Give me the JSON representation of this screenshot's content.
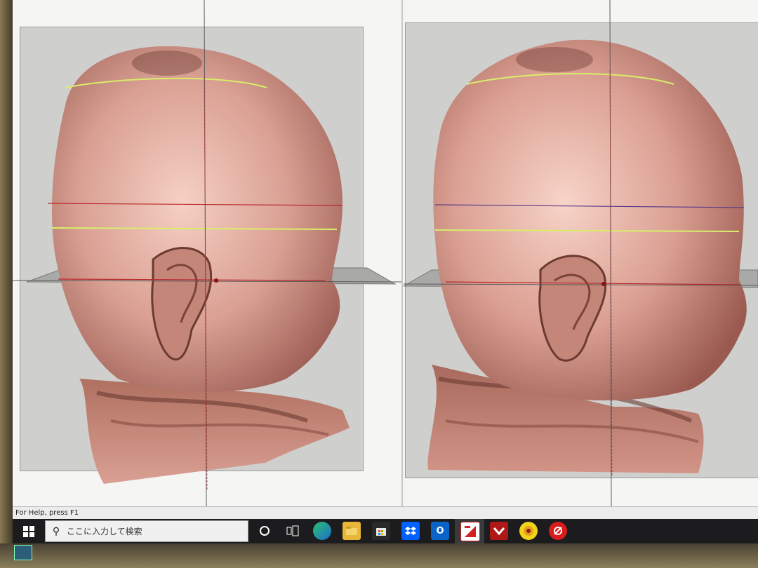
{
  "status_bar": {
    "text": "For Help, press F1"
  },
  "taskbar": {
    "search_placeholder": "ここに入力して検索",
    "icons": [
      {
        "name": "start-icon"
      },
      {
        "name": "cortana-icon"
      },
      {
        "name": "task-view-icon"
      },
      {
        "name": "edge-icon"
      },
      {
        "name": "file-explorer-icon"
      },
      {
        "name": "store-icon"
      },
      {
        "name": "dropbox-icon"
      },
      {
        "name": "outlook-icon"
      },
      {
        "name": "app-red-white-icon"
      },
      {
        "name": "app-red-chevron-icon"
      },
      {
        "name": "app-yellow-logo-icon"
      },
      {
        "name": "app-red-circle-icon"
      }
    ]
  },
  "colors": {
    "skin": "#d99a8c",
    "guide_line_green": "#d8ee6a",
    "guide_line_red": "#b8282c",
    "viewport_bg": "#cfcfcd",
    "taskbar": "#1c1c1e"
  }
}
